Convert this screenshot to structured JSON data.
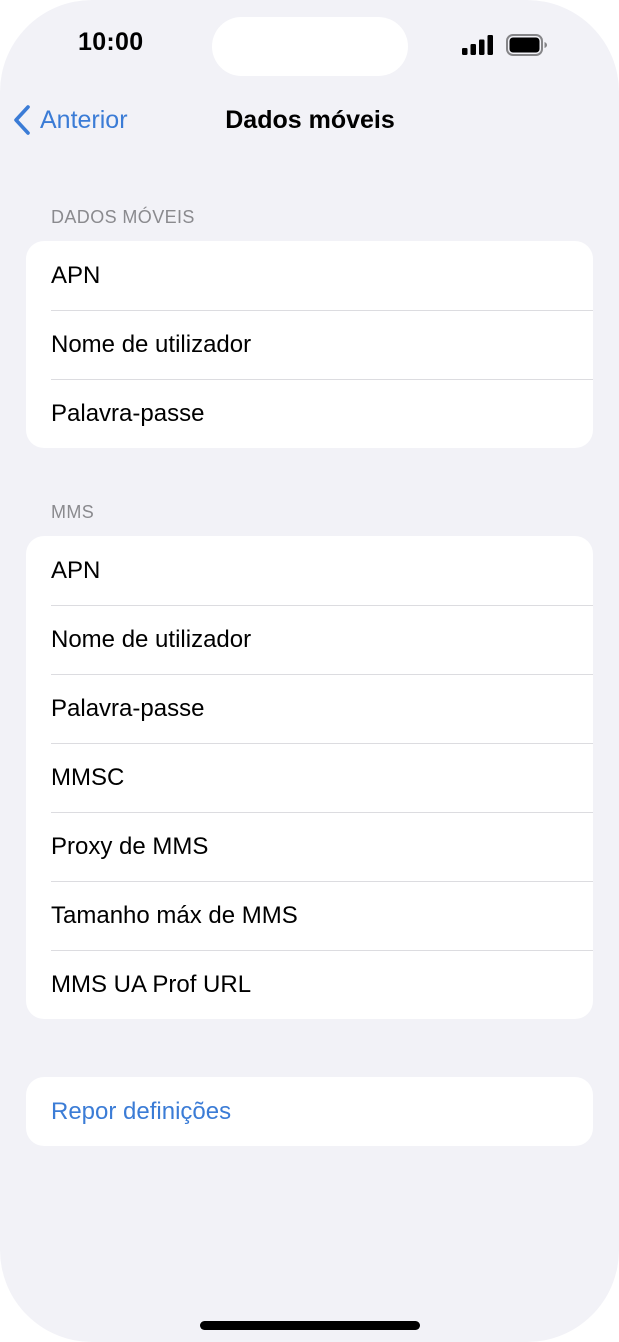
{
  "status_bar": {
    "time": "10:00"
  },
  "nav": {
    "back_label": "Anterior",
    "title": "Dados móveis"
  },
  "sections": {
    "mobile_data": {
      "header": "DADOS MÓVEIS",
      "rows": [
        "APN",
        "Nome de utilizador",
        "Palavra-passe"
      ]
    },
    "mms": {
      "header": "MMS",
      "rows": [
        "APN",
        "Nome de utilizador",
        "Palavra-passe",
        "MMSC",
        "Proxy de MMS",
        "Tamanho máx de MMS",
        "MMS UA Prof URL"
      ]
    },
    "reset": {
      "label": "Repor definições"
    }
  },
  "colors": {
    "background": "#f2f2f7",
    "accent": "#3b7cd6",
    "card": "#ffffff"
  }
}
